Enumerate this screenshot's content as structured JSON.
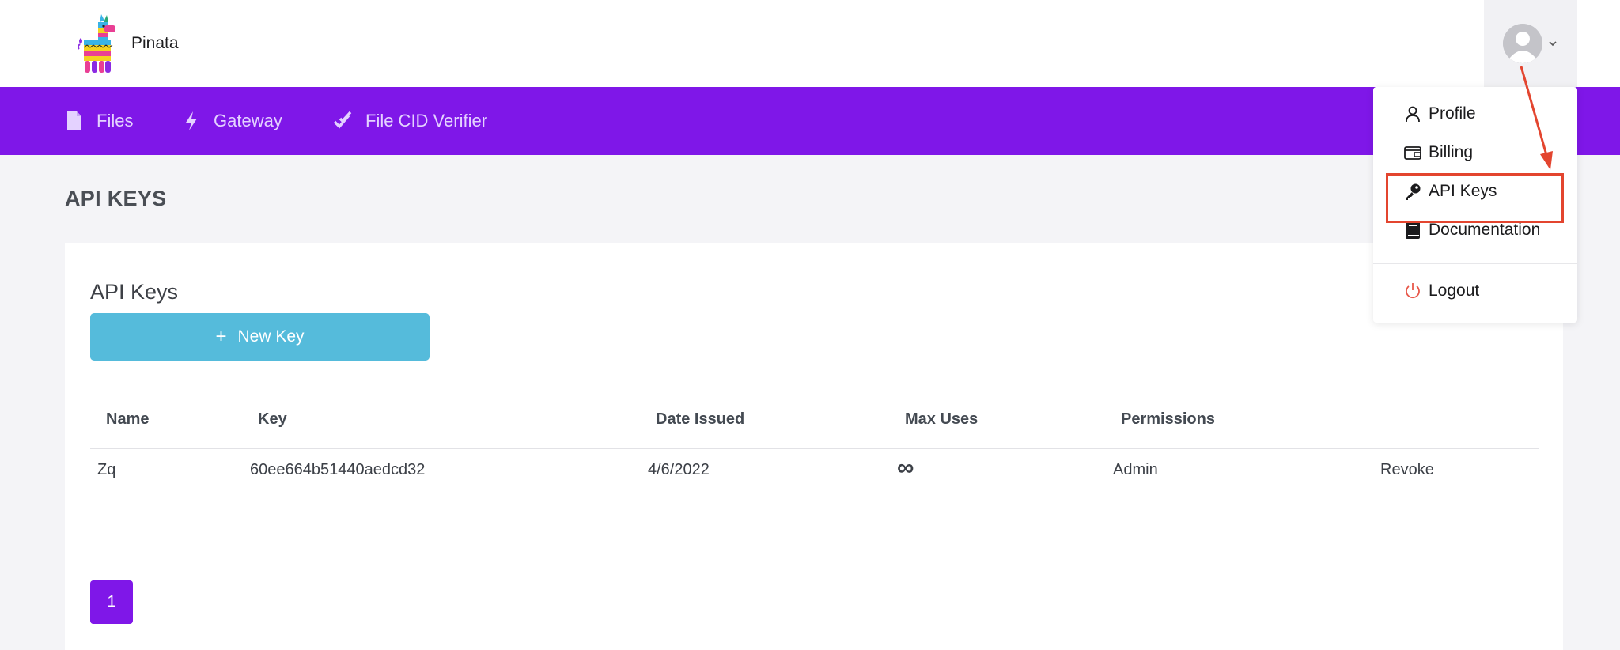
{
  "header": {
    "brand_name": "Pinata",
    "account_icon": "user-avatar-icon"
  },
  "nav": {
    "items": [
      {
        "label": "Files",
        "icon": "file-icon"
      },
      {
        "label": "Gateway",
        "icon": "lightning-icon"
      },
      {
        "label": "File CID Verifier",
        "icon": "double-check-icon"
      }
    ]
  },
  "page": {
    "title": "API KEYS"
  },
  "card": {
    "title": "API Keys",
    "new_key_label": "New Key"
  },
  "table": {
    "headers": [
      "Name",
      "Key",
      "Date Issued",
      "Max Uses",
      "Permissions"
    ],
    "rows": [
      {
        "name": "Zq",
        "key": "60ee664b51440aedcd32",
        "date_issued": "4/6/2022",
        "max_uses": "∞",
        "permissions": "Admin",
        "action": "Revoke"
      }
    ]
  },
  "pagination": {
    "current_page": "1"
  },
  "dropdown": {
    "items": [
      {
        "label": "Profile",
        "icon": "person-icon"
      },
      {
        "label": "Billing",
        "icon": "wallet-icon"
      },
      {
        "label": "API Keys",
        "icon": "key-icon"
      },
      {
        "label": "Documentation",
        "icon": "book-icon"
      },
      {
        "label": "Logout",
        "icon": "power-icon"
      }
    ]
  },
  "colors": {
    "brand_purple": "#7f17e8",
    "button_blue": "#55bbdb",
    "annotation_red": "#e3452f",
    "logout_red": "#e8584a"
  }
}
